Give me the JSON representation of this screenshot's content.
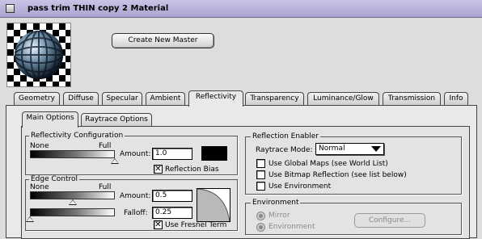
{
  "window": {
    "title": "pass trim THIN copy 2 Material"
  },
  "buttons": {
    "create_master": "Create New Master",
    "configure": "Configure..."
  },
  "tabs": [
    {
      "label": "Geometry"
    },
    {
      "label": "Diffuse"
    },
    {
      "label": "Specular"
    },
    {
      "label": "Ambient"
    },
    {
      "label": "Reflectivity",
      "active": true
    },
    {
      "label": "Transparency"
    },
    {
      "label": "Luminance/Glow"
    },
    {
      "label": "Transmission"
    },
    {
      "label": "Info"
    }
  ],
  "subtabs": [
    {
      "label": "Main Options",
      "active": true
    },
    {
      "label": "Raytrace Options"
    }
  ],
  "reflectivity_config": {
    "title": "Reflectivity Configuration",
    "slider_min": "None",
    "slider_max": "Full",
    "amount_label": "Amount:",
    "amount_value": "1.0",
    "amount_fraction": 1.0,
    "color_swatch": "#000000",
    "reflection_bias_label": "Reflection Bias",
    "reflection_bias_checked": true
  },
  "edge_control": {
    "title": "Edge Control",
    "slider_min": "None",
    "slider_max": "Full",
    "amount_label": "Amount:",
    "amount_value": "0.5",
    "amount_fraction": 0.5,
    "falloff_label": "Falloff:",
    "falloff_value": "0.25",
    "falloff_fraction": 0.0,
    "fresnel_label": "Use Fresnel Term",
    "fresnel_checked": true
  },
  "reflection_enabler": {
    "title": "Reflection Enabler",
    "raytrace_mode_label": "Raytrace Mode:",
    "raytrace_mode_value": "Normal",
    "checkboxes": [
      {
        "label": "Use Global Maps (see World List)",
        "checked": false
      },
      {
        "label": "Use Bitmap Reflection (see list below)",
        "checked": false
      },
      {
        "label": "Use Environment",
        "checked": false
      }
    ]
  },
  "environment": {
    "title": "Environment",
    "radios": [
      {
        "label": "Mirror"
      },
      {
        "label": "Environment"
      }
    ]
  },
  "icons": {
    "preview": "material-preview-sphere",
    "close": "close-box-icon",
    "dropdown": "triangle-down-icon",
    "check": "checkmark-icon"
  }
}
